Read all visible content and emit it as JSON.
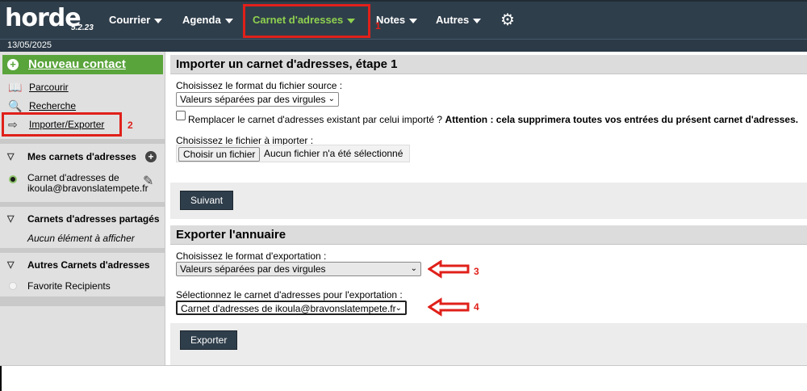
{
  "header": {
    "logo": "horde",
    "version": "5.2.23",
    "nav": [
      {
        "label": "Courrier"
      },
      {
        "label": "Agenda"
      },
      {
        "label": "Carnet d'adresses"
      },
      {
        "label": "Notes"
      },
      {
        "label": "Autres"
      }
    ],
    "settings_icon": "gear-icon",
    "date": "13/05/2025"
  },
  "sidebar": {
    "new_contact": "Nouveau contact",
    "links": [
      {
        "label": "Parcourir",
        "icon": "book-icon"
      },
      {
        "label": "Recherche",
        "icon": "search-icon"
      },
      {
        "label": "Importer/Exporter",
        "icon": "import-export-icon"
      }
    ],
    "my_books": {
      "title": "Mes carnets d'adresses",
      "items": [
        {
          "line1": "Carnet d'adresses de",
          "line2": "ikoula@bravonslatempete.fr"
        }
      ]
    },
    "shared_books": {
      "title": "Carnets d'adresses partagés",
      "empty": "Aucun élément à afficher"
    },
    "other_books": {
      "title": "Autres Carnets d'adresses",
      "items": [
        {
          "label": "Favorite Recipients"
        }
      ]
    }
  },
  "import": {
    "title": "Importer un carnet d'adresses, étape 1",
    "format_label": "Choisissez le format du fichier source :",
    "format_value": "Valeurs séparées par des virgules",
    "replace_label": "Remplacer le carnet d'adresses existant par celui importé ?",
    "replace_warning": "Attention : cela supprimera toutes vos entrées du présent carnet d'adresses.",
    "file_label": "Choisissez le fichier à importer :",
    "file_button": "Choisir un fichier",
    "file_status": "Aucun fichier n'a été sélectionné",
    "next_button": "Suivant"
  },
  "export": {
    "title": "Exporter l'annuaire",
    "format_label": "Choisissez le format d'exportation :",
    "format_value": "Valeurs séparées par des virgules",
    "book_label": "Sélectionnez le carnet d'adresses pour l'exportation :",
    "book_value": "Carnet d'adresses de ikoula@bravonslatempete.fr",
    "export_button": "Exporter"
  },
  "annotations": {
    "marker_1": "1",
    "marker_2": "2",
    "marker_3": "3",
    "marker_4": "4",
    "color": "#e0201a"
  }
}
